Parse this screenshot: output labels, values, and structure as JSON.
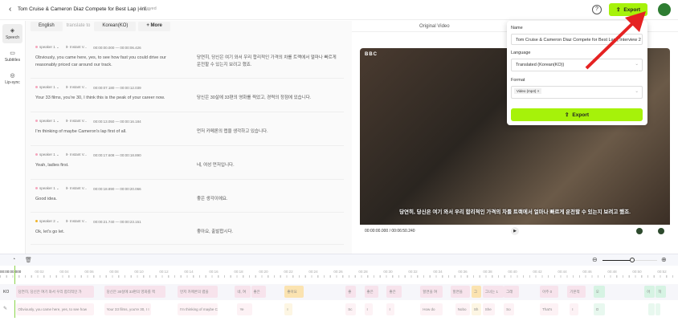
{
  "header": {
    "back_icon": "chevron-left-icon",
    "title": "Tom Cruise & Cameron Diaz Compete for Best Lap | Int...",
    "saved": "Saved",
    "export_label": "Export",
    "accent": "#a6f20a"
  },
  "rail": [
    {
      "label": "Speech",
      "icon": "speech-icon"
    },
    {
      "label": "Subtitles",
      "icon": "subtitles-icon"
    },
    {
      "label": "Lip-sync",
      "icon": "lip-sync-icon"
    }
  ],
  "lang": {
    "source": "English",
    "translate_to": "translate to",
    "target": "Korean(KO)",
    "more": "+ More"
  },
  "segments": [
    {
      "speaker": "speaker 1",
      "voice": "Instant V...",
      "start": "00:00:00.000",
      "end": "00:00:06.426",
      "en": "Obviously, you came here, yes, to see how fast you could drive our reasonably priced car around our track.",
      "ko": "당연히, 당신은 여기 와서 우리 합리적인 가격의 차를 트랙에서 얼마나 빠르게 운전할 수 있는지 보려고 했죠."
    },
    {
      "speaker": "speaker 1",
      "voice": "Instant V...",
      "start": "00:00:07.180",
      "end": "00:00:12.039",
      "en": "Your 33 films, you're 30, I think this is the peak of your career now.",
      "ko": "당신은 30살에 33편의 영화를 찍었고, 경력의 정점에 있습니다."
    },
    {
      "speaker": "speaker 1",
      "voice": "Instant V...",
      "start": "00:00:13.050",
      "end": "00:00:16.184",
      "en": "I'm thinking of maybe Cameron's lap first of all.",
      "ko": "먼저 카메론의 랩을 생각하고 있습니다."
    },
    {
      "speaker": "speaker 1",
      "voice": "Instant V...",
      "start": "00:00:17.608",
      "end": "00:00:18.890",
      "en": "Yeah, ladies first.",
      "ko": "네, 여성 먼저입니다."
    },
    {
      "speaker": "speaker 1",
      "voice": "Instant V...",
      "start": "00:00:18.890",
      "end": "00:00:20.066",
      "en": "Good idea.",
      "ko": "좋은 생각이에요."
    },
    {
      "speaker": "speaker 2",
      "voice": "Instant V...",
      "start": "00:00:21.740",
      "end": "00:00:23.151",
      "en": "Ok, let's go let.",
      "ko": "좋아요, 출발합시다."
    }
  ],
  "video": {
    "tab": "Original Video",
    "logo": "BBC",
    "subtitle": "당연히, 당신은 여기 와서 우리 합리적인 가격의 차를 트랙에서 얼마나 빠르게 운전할 수 있는지 보려고 했죠.",
    "time": "00:00:00.000 / 00:06:50.240"
  },
  "popup": {
    "name_label": "Name",
    "name_value": "Tom Cruise & Cameron Diaz Compete for Best Lap | Interview 2",
    "language_label": "Language",
    "language_value": "Translated (Korean(KO))",
    "format_label": "Format",
    "format_tag": "Video (mp4)",
    "export_label": "Export"
  },
  "timeline": {
    "current": "00:00:00.000",
    "zoom_level": 0.55,
    "track_ko_label": "KO",
    "ticks": [
      "00:02",
      "00:04",
      "00:06",
      "00:08",
      "00:10",
      "00:12",
      "00:14",
      "00:16",
      "00:18",
      "00:20",
      "00:22",
      "00:24",
      "00:26",
      "00:28",
      "00:30",
      "00:32",
      "00:34",
      "00:36",
      "00:38",
      "00:40",
      "00:42",
      "00:44",
      "00:46",
      "00:48",
      "00:50",
      "00:52"
    ],
    "ko_blocks": [
      {
        "s": 0.1,
        "e": 6.4,
        "t": "당연히, 당신은 여기 와서 우리 합리적인 가",
        "c": "#f7e3ec"
      },
      {
        "s": 7.2,
        "e": 12.1,
        "t": "당신은 30살에 33편의 영화를 찍",
        "c": "#f7e3ec"
      },
      {
        "s": 13.1,
        "e": 16.3,
        "t": "먼저 카메론의 랩을",
        "c": "#f7e3ec"
      },
      {
        "s": 17.7,
        "e": 19.0,
        "t": "네, 여",
        "c": "#f7e3ec"
      },
      {
        "s": 19.0,
        "e": 20.2,
        "t": "좋은",
        "c": "#f7e3ec"
      },
      {
        "s": 21.7,
        "e": 23.2,
        "t": "좋아요",
        "c": "#fbe3b0"
      },
      {
        "s": 26.6,
        "e": 27.4,
        "t": "좋",
        "c": "#f7e3ec"
      },
      {
        "s": 28.1,
        "e": 29.2,
        "t": "좋은",
        "c": "#f7e3ec"
      },
      {
        "s": 29.9,
        "e": 31.1,
        "t": "좋은",
        "c": "#f7e3ec"
      },
      {
        "s": 32.6,
        "e": 34.4,
        "t": "할면을 여",
        "c": "#f7e3ec"
      },
      {
        "s": 35.0,
        "e": 36.6,
        "t": "할면을",
        "c": "#f7e3ec"
      },
      {
        "s": 36.7,
        "e": 37.5,
        "t": "그",
        "c": "#fbe3b0"
      },
      {
        "s": 37.6,
        "e": 39.3,
        "t": "그녀는 1",
        "c": "#f7e3ec"
      },
      {
        "s": 39.3,
        "e": 40.5,
        "t": "그래",
        "c": "#f7e3ec"
      },
      {
        "s": 42.2,
        "e": 43.7,
        "t": "아주 0",
        "c": "#f7e3ec"
      },
      {
        "s": 44.4,
        "e": 45.9,
        "t": "기본적",
        "c": "#f7e3ec"
      },
      {
        "s": 46.5,
        "e": 47.4,
        "t": "오",
        "c": "#d6f3e3"
      },
      {
        "s": 50.6,
        "e": 51.4,
        "t": "어",
        "c": "#d6f3e3"
      },
      {
        "s": 51.5,
        "e": 52.3,
        "t": "히",
        "c": "#d6f3e3"
      }
    ],
    "en_blocks": [
      {
        "s": 0.1,
        "e": 6.4,
        "t": "Obviously, you came here, yes, to see how",
        "c": "#fdf2f5"
      },
      {
        "s": 7.2,
        "e": 11.0,
        "t": "Your 33 films, you're 30, I I",
        "c": "#fdf2f5"
      },
      {
        "s": 13.1,
        "e": 16.3,
        "t": "I'm thinking of maybe C",
        "c": "#fdf2f5"
      },
      {
        "s": 17.9,
        "e": 19.1,
        "t": "Ye",
        "c": "#fdf2f5"
      },
      {
        "s": 21.7,
        "e": 22.3,
        "t": "I",
        "c": "#fdf6e3"
      },
      {
        "s": 26.6,
        "e": 27.4,
        "t": "Sc",
        "c": "#fdf2f5"
      },
      {
        "s": 28.1,
        "e": 28.8,
        "t": "I",
        "c": "#fdf2f5"
      },
      {
        "s": 29.9,
        "e": 30.5,
        "t": "I",
        "c": "#fdf2f5"
      },
      {
        "s": 32.6,
        "e": 34.4,
        "t": "How do",
        "c": "#fdf2f5"
      },
      {
        "s": 35.4,
        "e": 36.6,
        "t": "Nobo",
        "c": "#fdf2f5"
      },
      {
        "s": 36.7,
        "e": 37.5,
        "t": "Sh",
        "c": "#fdf6e3"
      },
      {
        "s": 37.6,
        "e": 38.6,
        "t": "She",
        "c": "#fdf2f5"
      },
      {
        "s": 39.3,
        "e": 40.1,
        "t": "So",
        "c": "#fdf2f5"
      },
      {
        "s": 42.2,
        "e": 43.7,
        "t": "That's",
        "c": "#fdf2f5"
      },
      {
        "s": 44.6,
        "e": 45.3,
        "t": "I",
        "c": "#fdf2f5"
      },
      {
        "s": 46.5,
        "e": 47.4,
        "t": "O",
        "c": "#e8f8ef"
      },
      {
        "s": 50.9,
        "e": 51.4,
        "t": "",
        "c": "#e8f8ef"
      },
      {
        "s": 51.5,
        "e": 51.9,
        "t": "",
        "c": "#e8f8ef"
      }
    ]
  }
}
